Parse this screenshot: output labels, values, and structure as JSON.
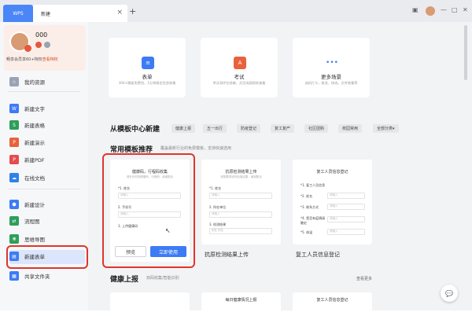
{
  "titlebar": {
    "app_label": "WPS",
    "tab_label": "新建",
    "close_glyph": "×",
    "add_glyph": "+",
    "window_controls": [
      "▣",
      "—",
      "□",
      "✕"
    ]
  },
  "profile": {
    "name": "000",
    "promo_text": "畅享会员享60+特权",
    "promo_link": "查看特权"
  },
  "sidebar": {
    "items": [
      {
        "label": "我的资源",
        "icon": "star-icon",
        "color": "#9aa3b2"
      },
      {
        "label": "新建文字",
        "icon": "doc-icon",
        "color": "#3d7bf5"
      },
      {
        "label": "新建表格",
        "icon": "sheet-icon",
        "color": "#2e9e5b"
      },
      {
        "label": "新建演示",
        "icon": "ppt-icon",
        "color": "#e8623b"
      },
      {
        "label": "新建PDF",
        "icon": "pdf-icon",
        "color": "#e54c4c"
      },
      {
        "label": "在线文档",
        "icon": "cloud-doc-icon",
        "color": "#2f83e8"
      },
      {
        "label": "新建设计",
        "icon": "design-icon",
        "color": "#3d7bf5"
      },
      {
        "label": "流程图",
        "icon": "flowchart-icon",
        "color": "#2e9e5b"
      },
      {
        "label": "思维导图",
        "icon": "mindmap-icon",
        "color": "#2e9e5b"
      },
      {
        "label": "新建表单",
        "icon": "form-icon",
        "color": "#3d7bf5"
      },
      {
        "label": "共享文件夹",
        "icon": "folder-icon",
        "color": "#3d7bf5"
      }
    ]
  },
  "top_cards": [
    {
      "title": "表单",
      "desc": "300+模板免费用，1分钟搞定信息收集",
      "icon": "list-icon",
      "color": "#3d7bf5"
    },
    {
      "title": "考试",
      "desc": "考试测评在线做，灵活成绩即刻查看",
      "icon": "exam-icon",
      "color": "#e8623b"
    },
    {
      "title": "更多场景",
      "desc": "选码打卡，接龙、快选，文件收集等",
      "icon": "more-icon",
      "color": "#3d7bf5"
    }
  ],
  "template_center": {
    "title": "从模板中心新建",
    "chips": [
      "健康上报",
      "五一出行",
      "防疫登记",
      "复工复产",
      "社区团购",
      "校园常用",
      "全部分类▾"
    ]
  },
  "common_templates": {
    "title": "常用模板推荐",
    "subtitle": "覆盖最新行业的免费模板，支持快速选用",
    "cards": [
      {
        "title": "健康码，行程码收集",
        "subtitle": "请补充你的健康码，行程码，谢谢配合",
        "fields": [
          "*1. 姓名",
          "2. 手机号",
          "3. 上传健康码"
        ],
        "placeholders": [
          "请输入",
          "请输入",
          ""
        ],
        "preview_label": "预览",
        "use_label": "立即使用"
      },
      {
        "title": "抗原检测结果上传",
        "subtitle": "请按要求填写检测结果，谢谢配合",
        "fields": [
          "*1. 姓名",
          "2. 所在单位",
          "3. 检测结果"
        ],
        "placeholders": [
          "请输入",
          "请输入",
          "阴性 阳性"
        ],
        "name": "抗原检测结果上传"
      },
      {
        "title": "复工人员信息登记",
        "subtitle": "",
        "fields": [
          "*1. 复工人员信息",
          "*2. 姓名",
          "*3. 联系方式",
          "*4. 是否有疫情接触史",
          "*5. 体温"
        ],
        "placeholders": [
          "请输入",
          "请输入",
          "请输入",
          "请输入"
        ],
        "name": "复工人员信息登记"
      }
    ]
  },
  "health_report": {
    "title": "健康上报",
    "subtitle": "双码收集/智能识别",
    "see_more": "查看更多",
    "card_titles": [
      "",
      "每日健康情况上报",
      "复工人员信息登记"
    ]
  },
  "chat_icon": "chat-icon"
}
